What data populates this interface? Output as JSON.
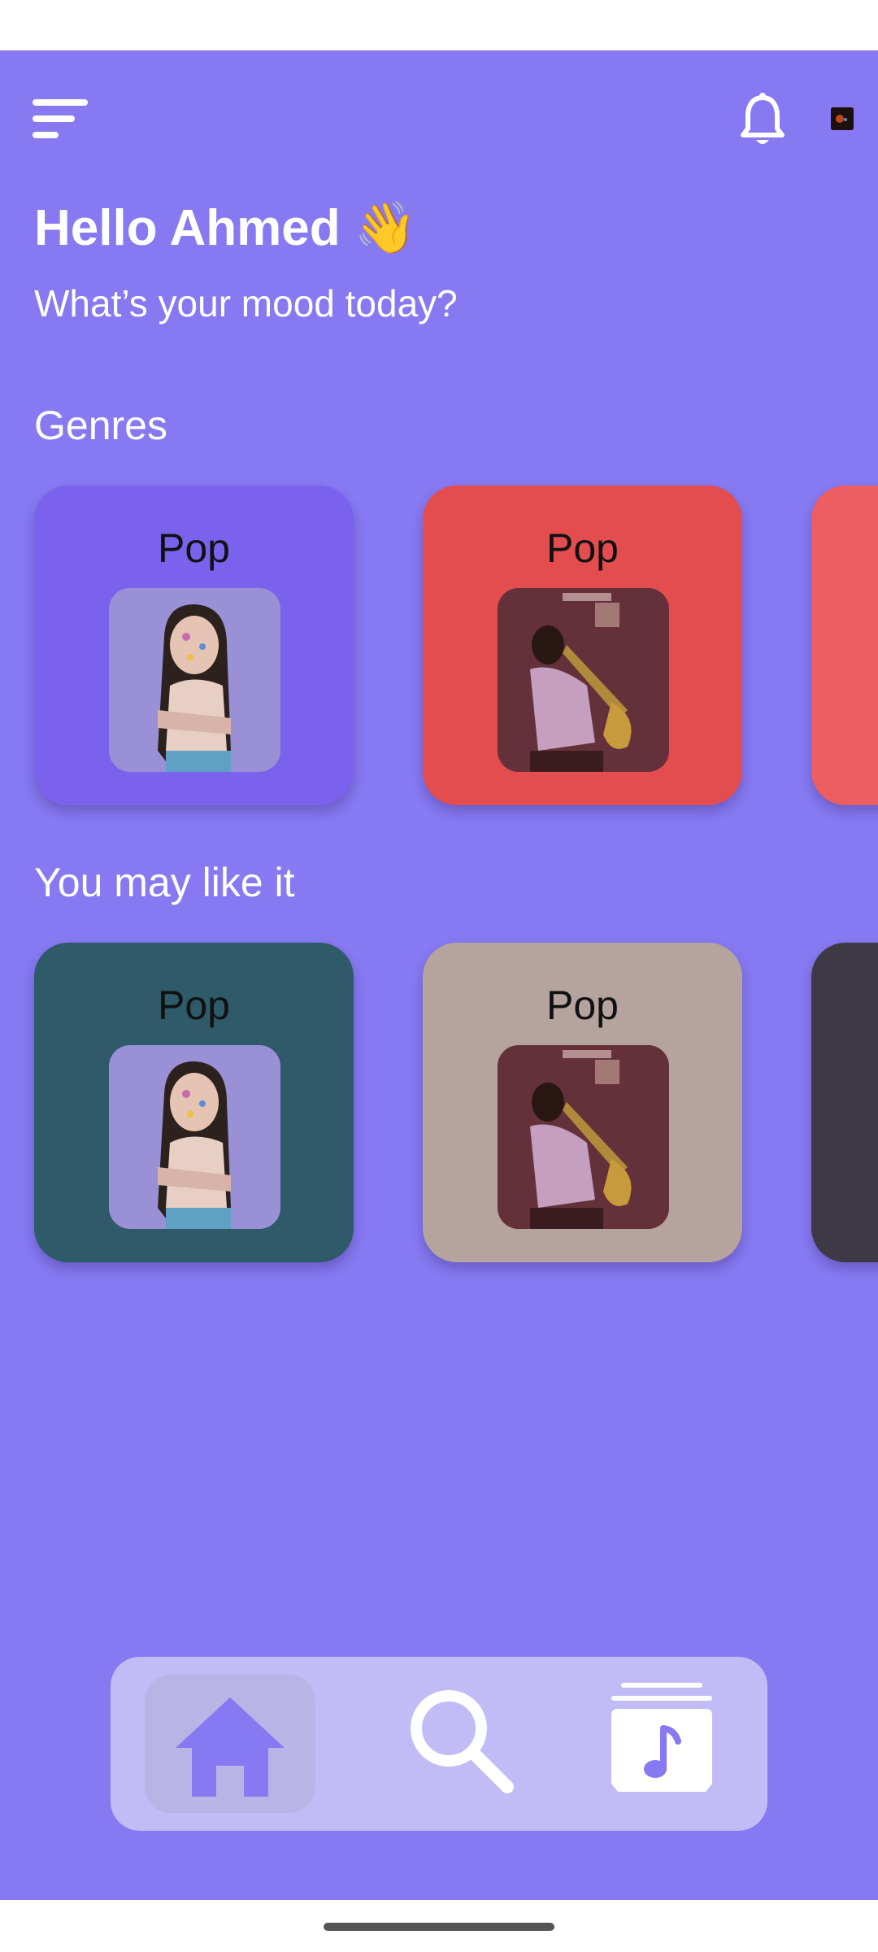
{
  "header": {
    "menu_icon": "menu-icon",
    "notification_icon": "bell-icon"
  },
  "greeting": {
    "title": "Hello Ahmed 👋",
    "subtitle": "What’s your mood today?"
  },
  "sections": {
    "genres": {
      "title": "Genres",
      "cards": [
        {
          "label": "Pop",
          "color": "#7A62ED",
          "cover": "pop-cover"
        },
        {
          "label": "Pop",
          "color": "#E34D4D",
          "cover": "sax-cover"
        },
        {
          "label": "",
          "color": "#EE5D5F"
        }
      ]
    },
    "you_may_like": {
      "title": "You may like it",
      "cards": [
        {
          "label": "Pop",
          "color": "#2E5A6A",
          "cover": "pop-cover"
        },
        {
          "label": "Pop",
          "color": "#B5A39E",
          "cover": "sax-cover"
        },
        {
          "label": "",
          "color": "#3D3A46"
        }
      ]
    }
  },
  "bottom_nav": {
    "items": [
      {
        "icon": "home-icon",
        "active": true
      },
      {
        "icon": "search-icon",
        "active": false
      },
      {
        "icon": "music-library-icon",
        "active": false
      }
    ],
    "icon_color": "#8679F1",
    "active_bg": "#BAB4E6",
    "bar_color": "#C1BBF6"
  },
  "colors": {
    "background": "#8679F1"
  }
}
